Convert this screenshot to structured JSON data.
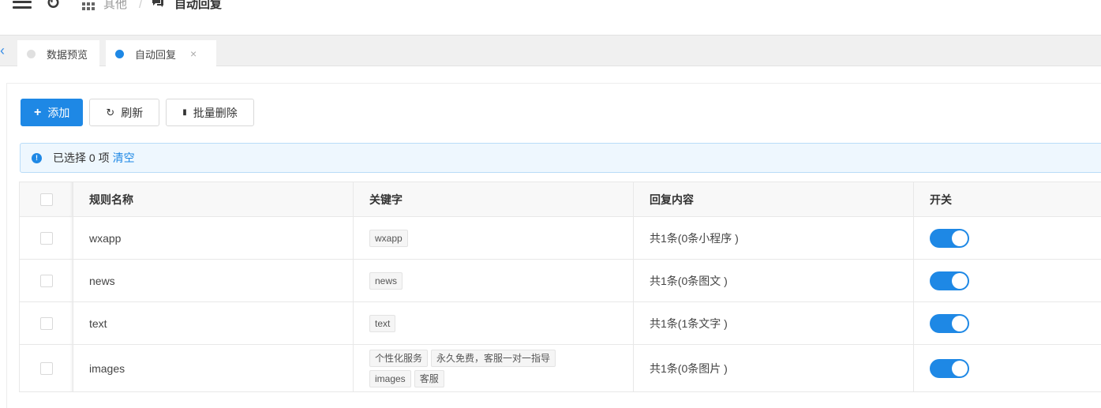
{
  "header": {
    "breadcrumb": [
      {
        "label": "其他"
      },
      {
        "label": "自动回复"
      }
    ],
    "separator": "/"
  },
  "tabs": [
    {
      "label": "数据预览",
      "active": false
    },
    {
      "label": "自动回复",
      "active": true,
      "close": "×"
    }
  ],
  "toolbar": {
    "add_icon": "+",
    "add_label": "添加",
    "refresh_icon": "C",
    "refresh_label": "刷新",
    "delete_icon": "▮",
    "delete_label": "批量删除"
  },
  "alert": {
    "icon": "!",
    "text": "已选择 0 项",
    "clear_label": "清空"
  },
  "table": {
    "columns": [
      "规则名称",
      "关键字",
      "回复内容",
      "开关"
    ],
    "rows": [
      {
        "name": "wxapp",
        "keywords": [
          "wxapp"
        ],
        "reply": "共1条(0条小程序 )",
        "enabled": true
      },
      {
        "name": "news",
        "keywords": [
          "news"
        ],
        "reply": "共1条(0条图文 )",
        "enabled": true
      },
      {
        "name": "text",
        "keywords": [
          "text"
        ],
        "reply": "共1条(1条文字 )",
        "enabled": true
      },
      {
        "name": "images",
        "keywords": [
          "个性化服务",
          "永久免费，客服一对一指导",
          "images",
          "客服"
        ],
        "reply": "共1条(0条图片 )",
        "enabled": true
      }
    ]
  },
  "colors": {
    "primary": "#1e88e5",
    "alert_bg": "#eef7fe"
  }
}
